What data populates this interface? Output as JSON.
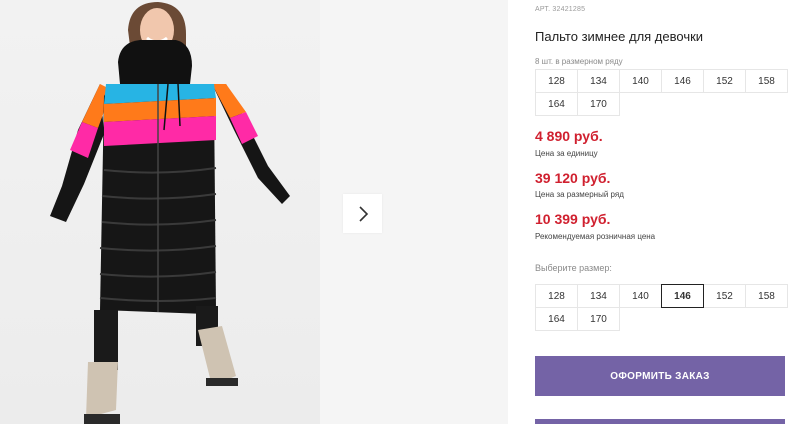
{
  "product": {
    "sku": "АРТ. 32421285",
    "title": "Пальто зимнее для девочки",
    "pack_label": "8 шт. в размерном ряду",
    "pack_sizes": [
      "128",
      "134",
      "140",
      "146",
      "152",
      "158",
      "164",
      "170"
    ],
    "prices": [
      {
        "value": "4 890 руб.",
        "caption": "Цена за единицу"
      },
      {
        "value": "39 120 руб.",
        "caption": "Цена за размерный ряд"
      },
      {
        "value": "10 399 руб.",
        "caption": "Рекомендуемая розничная цена"
      }
    ],
    "choose_label": "Выберите размер:",
    "select_sizes": [
      "128",
      "134",
      "140",
      "146",
      "152",
      "158",
      "164",
      "170"
    ],
    "selected_size": "146"
  },
  "actions": {
    "order_label": "ОФОРМИТЬ ЗАКАЗ"
  },
  "gallery": {
    "next_icon": "chevron-right-icon"
  },
  "colors": {
    "accent": "#7463a6",
    "price": "#d0202f",
    "coat_black": "#161616",
    "stripe_cyan": "#27b4e4",
    "stripe_orange": "#ff7a1a",
    "stripe_pink": "#ff2aa6"
  }
}
